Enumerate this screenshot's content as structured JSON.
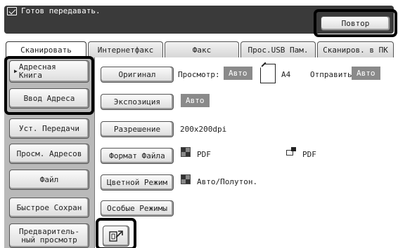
{
  "status": {
    "icon": "mail-icon",
    "text": "Готов передавать."
  },
  "header": {
    "repeat_label": "Повтор"
  },
  "tabs": [
    {
      "label": "Сканировать",
      "active": true
    },
    {
      "label": "Интернетфакс",
      "active": false
    },
    {
      "label": "Факс",
      "active": false
    },
    {
      "label": "Прос.USB Пам.",
      "active": false
    },
    {
      "label": "Сканиров. в ПК",
      "active": false
    }
  ],
  "sidebar": {
    "address_book_line1": "Адресная",
    "address_book_line2": "Книга",
    "address_entry": "Ввод Адреса",
    "send_settings": "Уст. Передачи",
    "view_addresses": "Просм. Адресов",
    "file": "Файл",
    "quick_save": "Быстрое Сохран",
    "preview_line1": "Предваритель-",
    "preview_line2": "ный просмотр"
  },
  "settings": {
    "original_label": "Оригинал",
    "preview_text": "Просмотр:",
    "preview_value": "Авто",
    "paper_size": "A4",
    "send_text": "Отправить",
    "send_value": "Авто",
    "exposure_label": "Экспозиция",
    "exposure_value": "Авто",
    "resolution_label": "Разрешение",
    "resolution_value": "200x200dpi",
    "file_format_label": "Формат Файла",
    "file_format_value_1": "PDF",
    "file_format_value_2": "PDF",
    "color_mode_label": "Цветной Режим",
    "color_mode_value": "Авто/Полутон.",
    "special_modes_label": "Особые Режимы"
  },
  "colors": {
    "status_bg": "#3a3a3a",
    "badge_bg": "#8a8a8a",
    "sidebar_bg": "#b9b9b9",
    "highlight": "#000000"
  }
}
